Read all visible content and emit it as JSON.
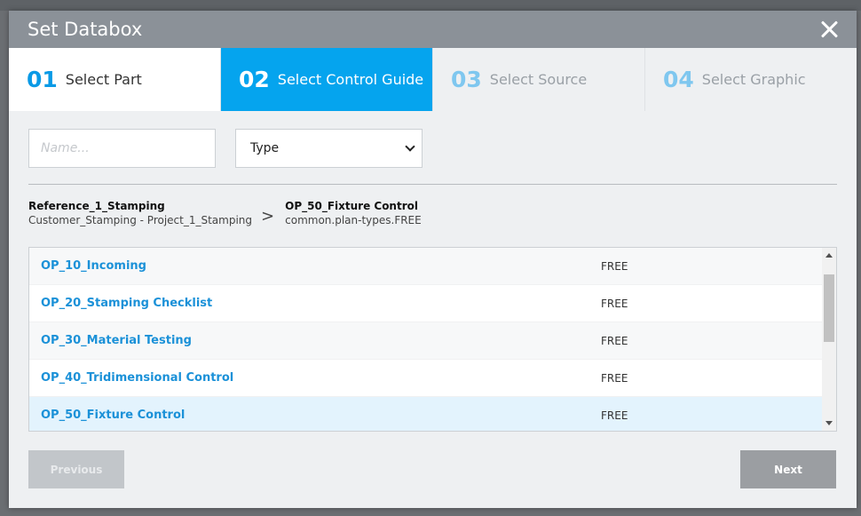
{
  "dialog": {
    "title": "Set Databox",
    "close_icon": "close-icon"
  },
  "steps": [
    {
      "num": "01",
      "label": "Select Part",
      "state": "done"
    },
    {
      "num": "02",
      "label": "Select Control Guide",
      "state": "active"
    },
    {
      "num": "03",
      "label": "Select Source",
      "state": "pending"
    },
    {
      "num": "04",
      "label": "Select Graphic",
      "state": "pending"
    }
  ],
  "filters": {
    "name_placeholder": "Name...",
    "name_value": "",
    "type_selected": "Type"
  },
  "breadcrumb": {
    "part_title": "Reference_1_Stamping",
    "part_sub": "Customer_Stamping - Project_1_Stamping",
    "separator": ">",
    "guide_title": "OP_50_Fixture Control",
    "guide_sub": "common.plan-types.FREE"
  },
  "table": {
    "rows": [
      {
        "name": "OP_10_Incoming",
        "type": "FREE",
        "selected": false
      },
      {
        "name": "OP_20_Stamping Checklist",
        "type": "FREE",
        "selected": false
      },
      {
        "name": "OP_30_Material Testing",
        "type": "FREE",
        "selected": false
      },
      {
        "name": "OP_40_Tridimensional Control",
        "type": "FREE",
        "selected": false
      },
      {
        "name": "OP_50_Fixture Control",
        "type": "FREE",
        "selected": true
      }
    ]
  },
  "footer": {
    "previous_label": "Previous",
    "next_label": "Next"
  },
  "colors": {
    "accent": "#05a4ee",
    "header": "#8b9198",
    "link": "#1b91d8",
    "selected_row": "#e3f3fd"
  }
}
